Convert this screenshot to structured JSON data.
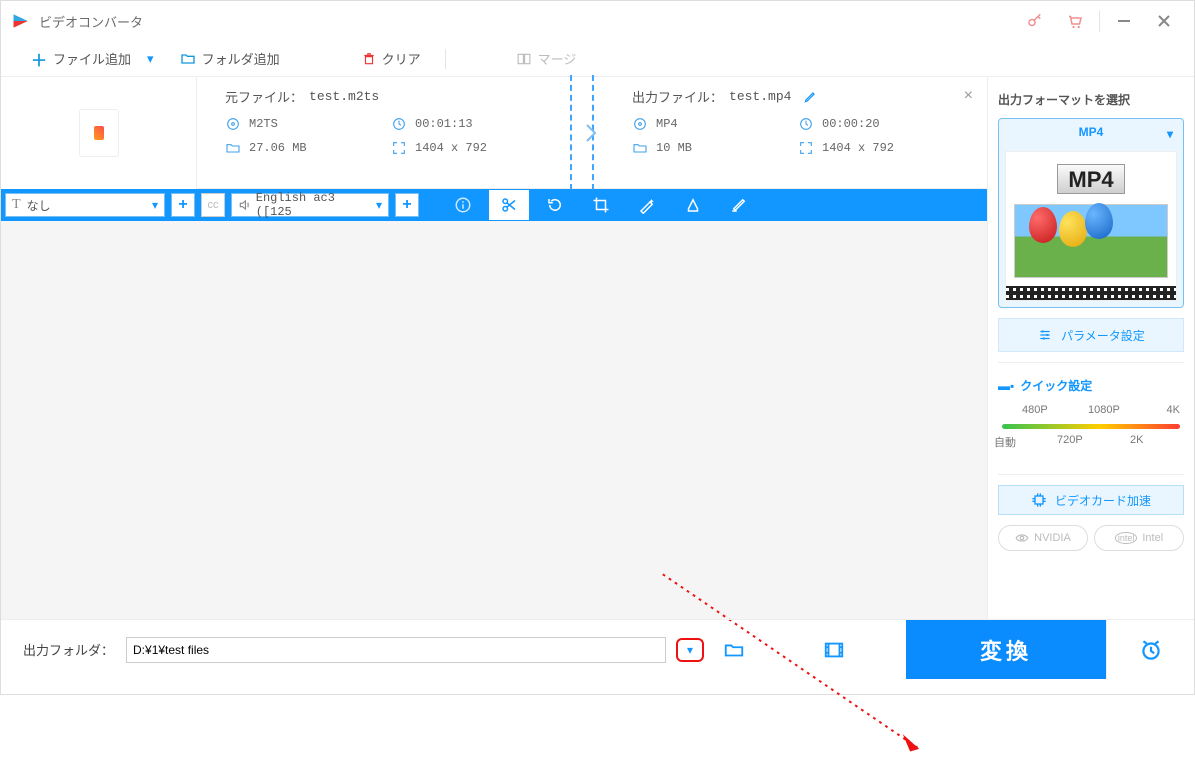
{
  "app": {
    "title": "ビデオコンバータ"
  },
  "toolbar": {
    "add_file": "ファイル追加",
    "add_folder": "フォルダ追加",
    "clear": "クリア",
    "merge": "マージ"
  },
  "item": {
    "source": {
      "prefix": "元ファイル：",
      "name": "test.m2ts",
      "format": "M2TS",
      "duration": "00:01:13",
      "size": "27.06 MB",
      "dimensions": "1404 x 792"
    },
    "output": {
      "prefix": "出力ファイル：",
      "name": "test.mp4",
      "format": "MP4",
      "duration": "00:00:20",
      "size": "10 MB",
      "dimensions": "1404 x 792"
    }
  },
  "actionbar": {
    "subtitle_sel": "なし",
    "audio_sel": "English ac3 ([125"
  },
  "sidebar": {
    "title": "出力フォーマットを選択",
    "format": "MP4",
    "format_badge": "MP4",
    "param_btn": "パラメータ設定",
    "quick_title": "クイック設定",
    "resolutions_top": {
      "p480": "480P",
      "p1080": "1080P",
      "p4k": "4K"
    },
    "resolutions_bot": {
      "auto": "自動",
      "p720": "720P",
      "p2k": "2K"
    },
    "gpu_label": "ビデオカード加速",
    "chips": {
      "nvidia": "NVIDIA",
      "intel": "Intel"
    }
  },
  "footer": {
    "label": "出力フォルダ：",
    "path": "D:¥1¥test files",
    "convert": "変換"
  }
}
